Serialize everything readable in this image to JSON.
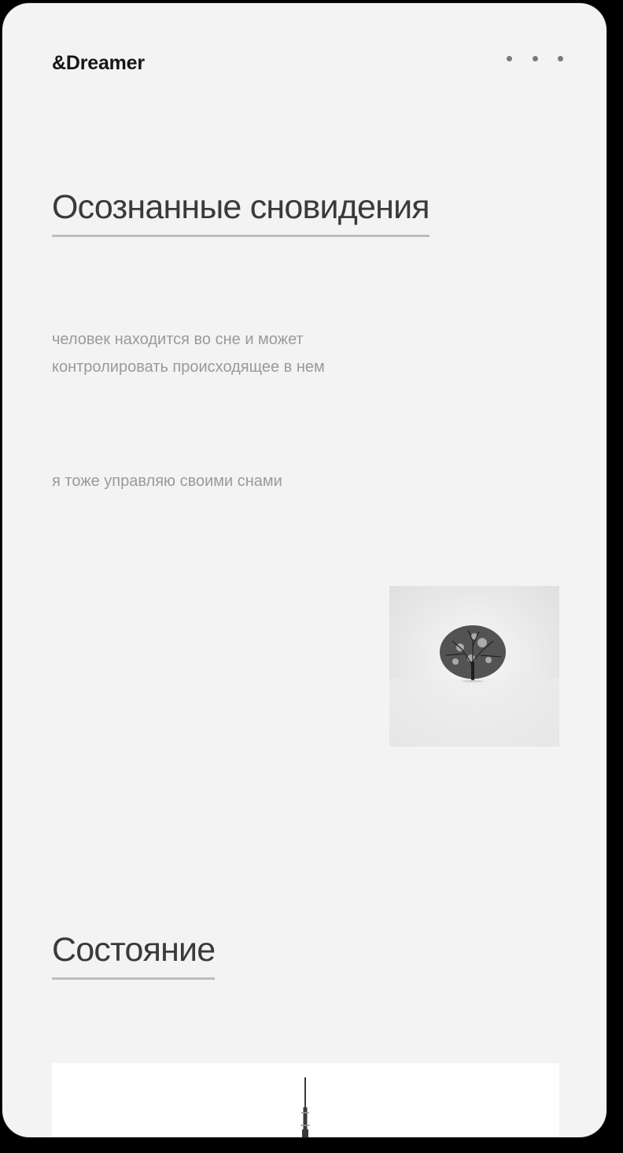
{
  "header": {
    "logo": "&Dreamer",
    "menu_icon": "more-dots-icon"
  },
  "section1": {
    "title": "Осознанные сновидения",
    "description_line1": "человек находится во сне и может",
    "description_line2": "контролировать происходящее в нем",
    "statement": "я тоже управляю своими снами",
    "image_icon": "lone-tree-image"
  },
  "section2": {
    "title": "Состояние",
    "image_icon": "tower-image"
  },
  "colors": {
    "background": "#f3f3f3",
    "heading": "#3a3a3a",
    "underline": "#bdbdbd",
    "muted_text": "#9a9a9a"
  }
}
